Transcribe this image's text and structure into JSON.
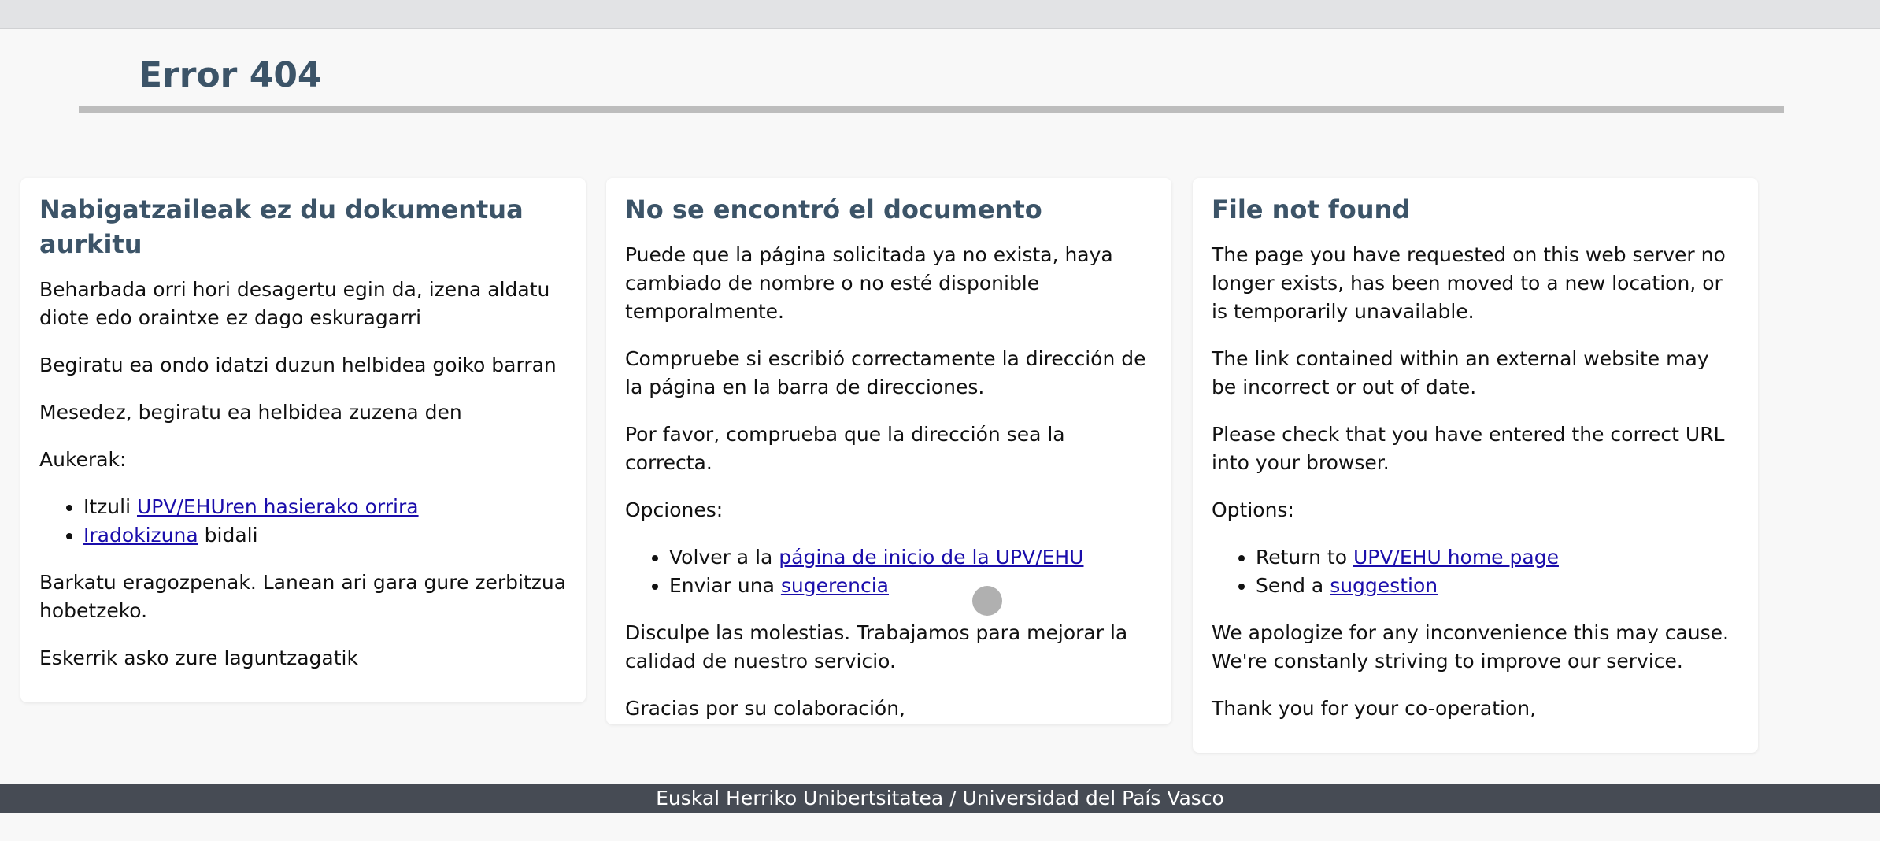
{
  "page": {
    "title": "Error 404"
  },
  "cards": {
    "eu": {
      "heading": "Nabigatzaileak ez du dokumentua aurkitu",
      "p1": "Beharbada orri hori desagertu egin da, izena aldatu diote edo oraintxe ez dago eskuragarri",
      "p2": "Begiratu ea ondo idatzi duzun helbidea goiko barran",
      "p3": "Mesedez, begiratu ea helbidea zuzena den",
      "options_label": "Aukerak:",
      "opt1_prefix": "Itzuli ",
      "opt1_link": "UPV/EHUren hasierako orrira",
      "opt2_link": "Iradokizuna",
      "opt2_suffix": " bidali",
      "apology": "Barkatu eragozpenak. Lanean ari gara gure zerbitzua hobetzeko.",
      "thanks": "Eskerrik asko zure laguntzagatik"
    },
    "es": {
      "heading": "No se encontró el documento",
      "p1": "Puede que la página solicitada ya no exista, haya cambiado de nombre o no esté disponible temporalmente.",
      "p2": "Compruebe si escribió correctamente la dirección de la página en la barra de direcciones.",
      "p3": "Por favor, comprueba que la dirección sea la correcta.",
      "options_label": "Opciones:",
      "opt1_prefix": "Volver a la ",
      "opt1_link": "página de inicio de la UPV/EHU",
      "opt2_prefix": "Enviar una ",
      "opt2_link": "sugerencia",
      "apology": "Disculpe las molestias. Trabajamos para mejorar la calidad de nuestro servicio.",
      "thanks": "Gracias por su colaboración,"
    },
    "en": {
      "heading": "File not found",
      "p1": "The page you have requested on this web server no longer exists, has been moved to a new location, or is temporarily unavailable.",
      "p2": "The link contained within an external website may be incorrect or out of date.",
      "p3": "Please check that you have entered the correct URL into your browser.",
      "options_label": "Options:",
      "opt1_prefix": "Return to ",
      "opt1_link": "UPV/EHU home page",
      "opt2_prefix": "Send a ",
      "opt2_link": "suggestion",
      "apology": "We apologize for any inconvenience this may cause. We're constanly striving to improve our service.",
      "thanks": "Thank you for your co-operation,"
    }
  },
  "footer": {
    "text": "Euskal Herriko Unibertsitatea / Universidad del País Vasco"
  },
  "colors": {
    "heading": "#3c5468",
    "link": "#1a0dab",
    "footer_bg": "#464b54"
  }
}
